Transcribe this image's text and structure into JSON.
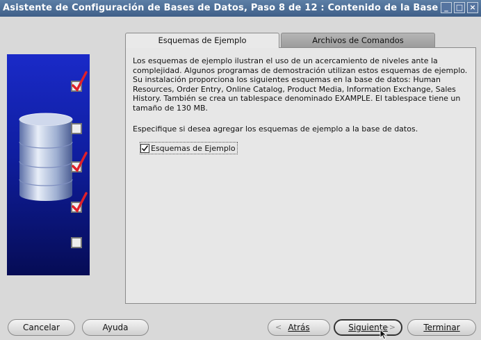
{
  "window": {
    "title": "Asistente de Configuración de Bases de Datos, Paso 8 de 12 : Contenido de la Base de D",
    "minimize_symbol": "_",
    "maximize_symbol": "□",
    "close_symbol": "×"
  },
  "sidebar": {
    "image_icon": "database-cylinder-icon",
    "steps": [
      {
        "checked": true
      },
      {
        "checked": false
      },
      {
        "checked": true
      },
      {
        "checked": true
      },
      {
        "checked": false
      }
    ]
  },
  "tabs": [
    {
      "label": "Esquemas de Ejemplo",
      "active": true
    },
    {
      "label": "Archivos de Comandos Personalizados",
      "active": false
    }
  ],
  "content": {
    "description_lines": [
      "Los esquemas de ejemplo ilustran el uso de un acercamiento de niveles ante la",
      "complejidad. Algunos programas de demostración utilizan estos esquemas de ejemplo.",
      "Su instalación proporciona los siguientes esquemas en la base de datos: Human",
      "Resources, Order Entry, Online Catalog, Product Media, Information Exchange, Sales",
      "History. También se crea un tablespace denominado EXAMPLE. El tablespace tiene un",
      "tamaño de 130 MB."
    ],
    "question": "Especifique si desea agregar los esquemas de ejemplo a la base de datos.",
    "checkbox": {
      "label": "Esquemas de Ejemplo",
      "checked": true
    }
  },
  "buttons": {
    "cancel": "Cancelar",
    "help": "Ayuda",
    "back": "Atrás",
    "back_arrow": "<",
    "next": "Siguiente",
    "next_arrow": ">>",
    "finish": "Terminar"
  },
  "colors": {
    "titlebar": "#4a6c96",
    "side_panel": "#1020b0",
    "checkmark": "#e0202a"
  }
}
